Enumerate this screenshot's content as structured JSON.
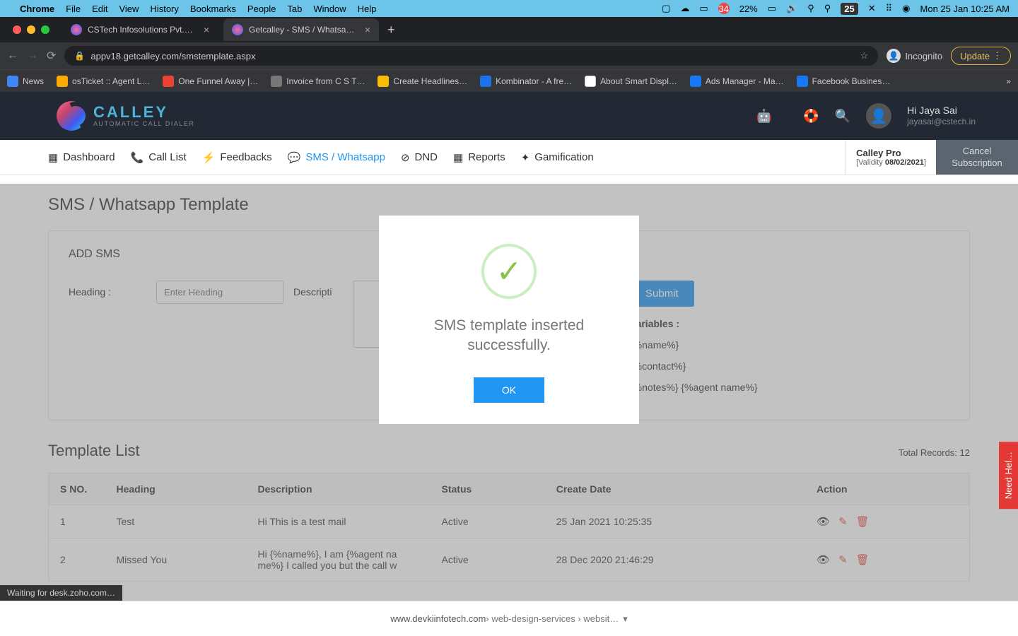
{
  "mac_menubar": {
    "app": "Chrome",
    "menus": [
      "File",
      "Edit",
      "View",
      "History",
      "Bookmarks",
      "People",
      "Tab",
      "Window",
      "Help"
    ],
    "notif_count": "34",
    "battery": "22%",
    "date_box": "25",
    "datetime": "Mon 25 Jan  10:25 AM"
  },
  "chrome": {
    "tabs": [
      {
        "title": "CSTech Infosolutions Pvt. Ltd.",
        "active": false
      },
      {
        "title": "Getcalley - SMS / Whatsapp Te",
        "active": true
      }
    ],
    "url": "appv18.getcalley.com/smstemplate.aspx",
    "incognito": "Incognito",
    "update": "Update",
    "bookmarks": [
      {
        "label": "News",
        "color": "#4285f4"
      },
      {
        "label": "osTicket :: Agent L…",
        "color": "#f9ab00"
      },
      {
        "label": "One Funnel Away |…",
        "color": "#ea4335"
      },
      {
        "label": "Invoice from C S T…",
        "color": "#777"
      },
      {
        "label": "Create Headlines…",
        "color": "#fbbc04"
      },
      {
        "label": "Kombinator - A fre…",
        "color": "#1a73e8"
      },
      {
        "label": "About Smart Displ…",
        "color": "#fff"
      },
      {
        "label": "Ads Manager - Ma…",
        "color": "#1877f2"
      },
      {
        "label": "Facebook Busines…",
        "color": "#1877f2"
      }
    ]
  },
  "app": {
    "logo_main": "CALLEY",
    "logo_sub": "AUTOMATIC CALL DIALER",
    "user_greeting": "Hi Jaya Sai",
    "user_email": "jayasai@cstech.in",
    "nav": {
      "dashboard": "Dashboard",
      "call_list": "Call List",
      "feedbacks": "Feedbacks",
      "sms": "SMS / Whatsapp",
      "dnd": "DND",
      "reports": "Reports",
      "gamification": "Gamification"
    },
    "plan": {
      "name": "Calley Pro",
      "validity_label": "[Validity ",
      "validity_date": "08/02/2021",
      "validity_close": "]",
      "cancel": "Cancel Subscription"
    }
  },
  "page_content": {
    "title": "SMS / Whatsapp Template",
    "add_sms_title": "ADD SMS",
    "heading_label": "Heading :",
    "heading_placeholder": "Enter Heading",
    "description_label": "Descripti",
    "submit": "Submit",
    "variables_title": "Variables :",
    "variables": [
      "{%name%}",
      "{%contact%}",
      "{%notes%} {%agent name%}"
    ],
    "list_title": "Template List",
    "total_records": "Total Records: 12",
    "columns": [
      "S NO.",
      "Heading",
      "Description",
      "Status",
      "Create Date",
      "Action"
    ],
    "rows": [
      {
        "sno": "1",
        "heading": "Test",
        "description": "Hi This is a test mail",
        "status": "Active",
        "date": "25 Jan 2021 10:25:35"
      },
      {
        "sno": "2",
        "heading": "Missed You",
        "description": "Hi {%name%}, I am {%agent na me%} I called you but the call w",
        "status": "Active",
        "date": "28 Dec 2020 21:46:29"
      }
    ]
  },
  "modal": {
    "message": "SMS template inserted successfully.",
    "ok": "OK"
  },
  "need_help": "Need Hel…",
  "status_bar": "Waiting for desk.zoho.com…",
  "search_result": {
    "domain": "www.devkiinfotech.com",
    "crumbs": " › web-design-services › websit…"
  }
}
